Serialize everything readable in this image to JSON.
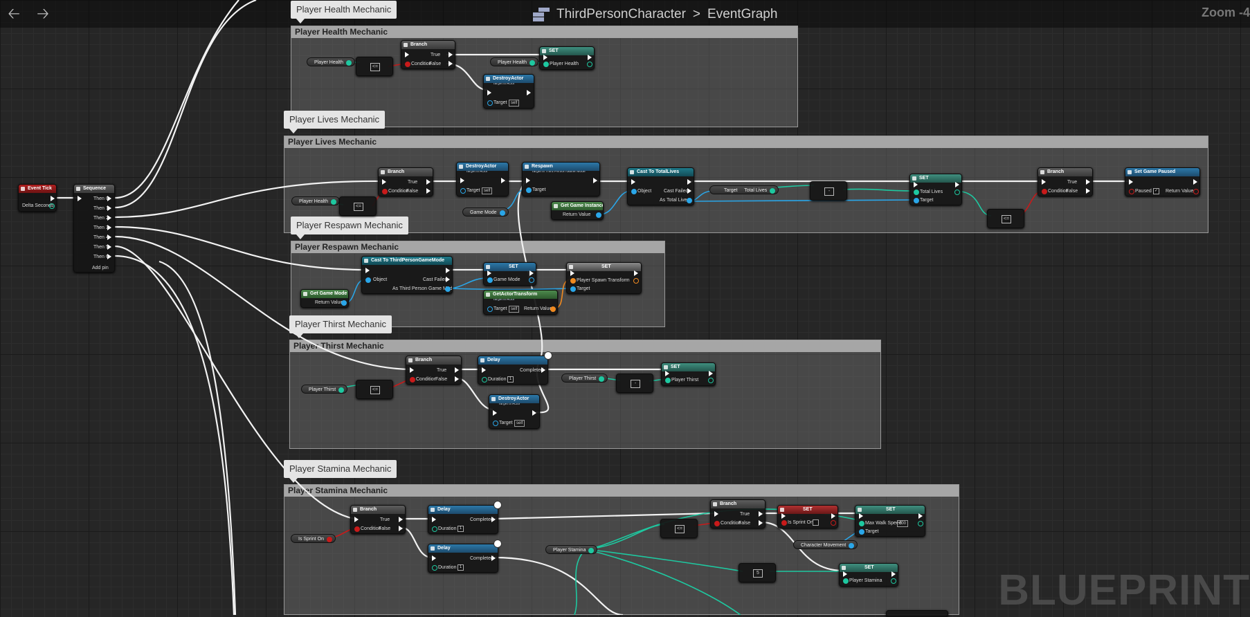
{
  "breadcrumb": {
    "blueprint": "ThirdPersonCharacter",
    "separator": ">",
    "graph": "EventGraph"
  },
  "zoom_label": "Zoom -4",
  "watermark": "BLUEPRINT",
  "comments": {
    "health": "Player Health Mechanic",
    "lives": "Player Lives Mechanic",
    "respawn": "Player Respawn Mechanic",
    "thirst": "Player Thirst Mechanic",
    "stamina": "Player Stamina Mechanic"
  },
  "event_tick": {
    "title": "Event Tick",
    "delta": "Delta Seconds"
  },
  "sequence": {
    "title": "Sequence",
    "pins": [
      "Then 0",
      "Then 1",
      "Then 2",
      "Then 3",
      "Then 4",
      "Then 5",
      "Then 6"
    ],
    "add": "Add pin"
  },
  "labels": {
    "branch": "Branch",
    "true": "True",
    "false": "False",
    "condition": "Condition",
    "set": "SET",
    "target": "Target",
    "self": "self",
    "target_is_actor": "Target is Actor",
    "destroy_actor": "DestroyActor",
    "delay": "Delay",
    "completed": "Completed",
    "duration": "Duration",
    "one": "1",
    "five": "5",
    "object": "Object",
    "cast_failed": "Cast Failed",
    "return_value": "Return Value"
  },
  "vars": {
    "player_health": "Player Health",
    "game_mode": "Game Mode",
    "target": "Target",
    "total_lives": "Total Lives",
    "player_thirst": "Player Thirst",
    "is_sprint_on": "Is Sprint On",
    "player_stamina": "Player Stamina",
    "character_movement": "Character Movement"
  },
  "lives_nodes": {
    "respawn": "Respawn",
    "respawn_target": "Target is Third Person Game Mode",
    "cast_total": "Cast To TotalLives",
    "as_total": "As Total Lives",
    "game_instance": "Get Game Instance",
    "set_paused": "Set Game Paused",
    "paused": "Paused"
  },
  "respawn_nodes": {
    "cast": "Cast To ThirdPersonGameMode",
    "as_tp": "As Third Person Game Mode",
    "get_game_mode": "Get Game Mode",
    "get_transform": "GetActorTransform",
    "spawn_transform": "Player Spawn Transform"
  },
  "stamina_nodes": {
    "max_walk": "Max Walk Speed",
    "max_walk_val": "600"
  }
}
